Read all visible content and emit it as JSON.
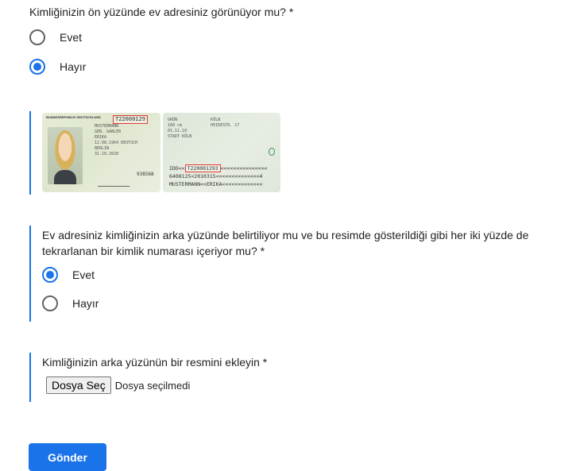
{
  "question1": {
    "title": "Kimliğinizin ön yüzünde ev adresiniz görünüyor mu? *",
    "options": [
      {
        "label": "Evet",
        "checked": false
      },
      {
        "label": "Hayır",
        "checked": true
      }
    ]
  },
  "id_image": {
    "front": {
      "header": "BUNDESREPUBLIK DEUTSCHLAND",
      "id_number": "T22000129",
      "lines": "MUSTERMANN\nGEB. GABLER\nERIKA\n12.08.1964 DEUTSCH\nBERLIN\n31.10.2020",
      "card_access": "938568"
    },
    "back": {
      "lines": "GRÜN              KÖLN\n160 cm            HEIDESTR. 17\n01.11.10\nSTADT KÖLN",
      "mrz_prefix": "IDD<<",
      "id_number": "T220001293",
      "mrz_line1_rest": "<<<<<<<<<<<<<<<",
      "mrz_line2": "6408125<2010315<<<<<<<<<<<<<<4",
      "mrz_line3": "MUSTERMANN<<ERIKA<<<<<<<<<<<<<"
    }
  },
  "question2": {
    "title": "Ev adresiniz kimliğinizin arka yüzünde belirtiliyor mu ve bu resimde gösterildiği gibi her iki yüzde de tekrarlanan bir kimlik numarası içeriyor mu? *",
    "options": [
      {
        "label": "Evet",
        "checked": true
      },
      {
        "label": "Hayır",
        "checked": false
      }
    ]
  },
  "question3": {
    "title": "Kimliğinizin arka yüzünün bir resmini ekleyin *",
    "file_button": "Dosya Seç",
    "file_status": "Dosya seçilmedi"
  },
  "submit_label": "Gönder",
  "colors": {
    "accent": "#1a73e8",
    "highlight": "#e53935"
  }
}
